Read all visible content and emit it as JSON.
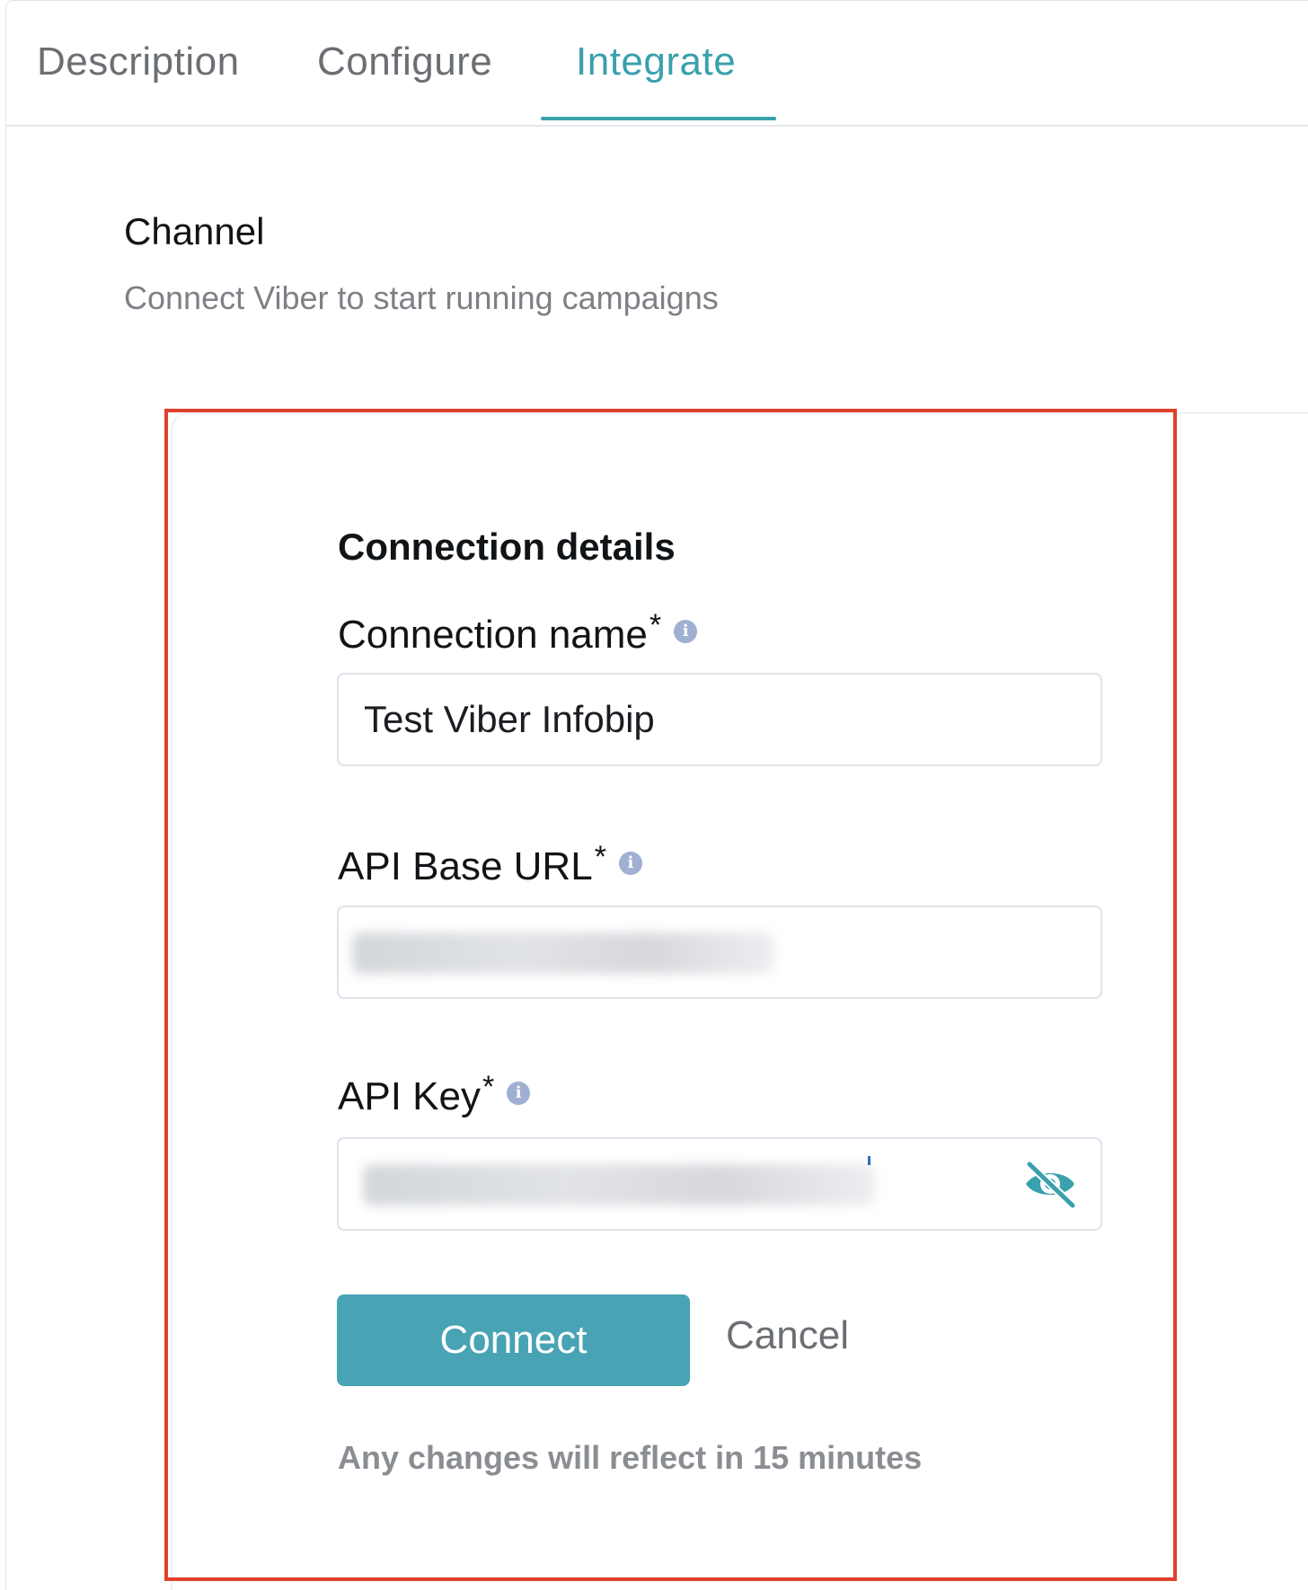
{
  "tabs": [
    {
      "label": "Description",
      "active": false
    },
    {
      "label": "Configure",
      "active": false
    },
    {
      "label": "Integrate",
      "active": true
    }
  ],
  "section": {
    "title": "Channel",
    "subtitle": "Connect Viber to start running campaigns"
  },
  "card": {
    "title": "Connection details",
    "fields": {
      "connection_name": {
        "label": "Connection name",
        "required_mark": "*",
        "value": "Test Viber Infobip",
        "icon": "info-icon"
      },
      "api_base_url": {
        "label": "API Base URL",
        "required_mark": "*",
        "value": "",
        "icon": "info-icon"
      },
      "api_key": {
        "label": "API Key",
        "required_mark": "*",
        "value": "",
        "icon": "info-icon",
        "toggle_icon": "eye-slash-icon"
      }
    },
    "actions": {
      "connect_label": "Connect",
      "cancel_label": "Cancel"
    },
    "note": "Any changes will reflect in 15 minutes"
  },
  "colors": {
    "accent": "#3aa0ad",
    "button": "#48a3b4",
    "highlight_border": "#e0402c",
    "info_icon": "#9fb0d2"
  }
}
